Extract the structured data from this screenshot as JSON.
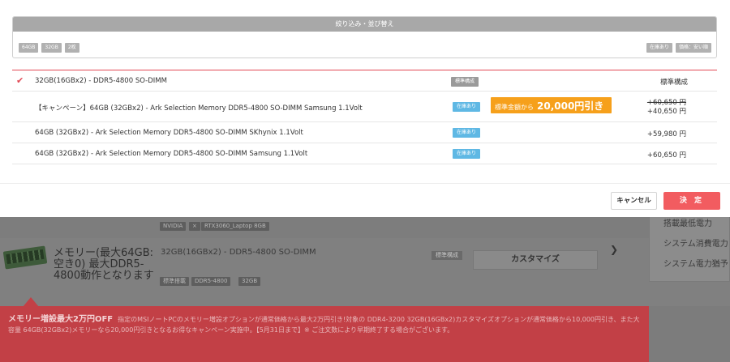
{
  "background": {
    "gpu_tags": [
      "NVIDIA",
      "×",
      "RTX3060_Laptop 8GB"
    ],
    "sidebar_items": [
      "搭載最低電力",
      "システム消費電力",
      "システム電力猶予"
    ],
    "memory_title": "メモリー(最大64GB:空き0) 最大DDR5-4800動作となります",
    "memory_value": "32GB(16GBx2) - DDR5-4800 SO-DIMM",
    "memory_std_badge": "標準構成",
    "memory_tags": [
      "標準搭載",
      "DDR5-4800",
      "32GB"
    ],
    "customize_label": "カスタマイズ",
    "chevron_icon": "chevron-down-icon",
    "banner_title": "メモリー増設最大2万円OFF",
    "banner_text": "指定のMSIノートPCのメモリー増設オプションが通常価格から最大2万円引き!対象の DDR4-3200 32GB(16GBx2)カスタマイズオプションが通常価格から10,000円引き、また大容量 64GB(32GBx2)メモリーなら20,000円引きとなるお得なキャンペーン実施中。【5月31日まで】※ ご注文数により早期終了する場合がございます。"
  },
  "modal": {
    "filter_title": "絞り込み・並び替え",
    "filter_chips": [
      "64GB",
      "32GB",
      "2枚"
    ],
    "sort_chips": [
      "在庫あり",
      "価格：安い順"
    ],
    "options": [
      {
        "name": "32GB(16GBx2) - DDR5-4800 SO-DIMM",
        "badge": "標準構成",
        "price": "標準構成",
        "selected": true
      },
      {
        "name": "【キャンペーン】64GB (32GBx2) - Ark Selection Memory DDR5-4800 SO-DIMM Samsung 1.1Volt",
        "badge": "在庫あり",
        "promo_prefix": "標準金額から",
        "promo_amount": "20,000円引き",
        "price_old": "+60,650 円",
        "price_new": "+40,650 円"
      },
      {
        "name": "64GB (32GBx2) - Ark Selection Memory DDR5-4800 SO-DIMM SKhynix 1.1Volt",
        "badge": "在庫あり",
        "price": "+59,980 円"
      },
      {
        "name": "64GB (32GBx2) - Ark Selection Memory DDR5-4800 SO-DIMM Samsung 1.1Volt",
        "badge": "在庫あり",
        "price": "+60,650 円"
      }
    ],
    "cancel_label": "キャンセル",
    "ok_label": "決 定"
  },
  "colors": {
    "accent_red": "#e24a55",
    "stock_blue": "#5fb8e4",
    "promo_orange": "#f6a01b",
    "confirm_red": "#f25c60"
  }
}
